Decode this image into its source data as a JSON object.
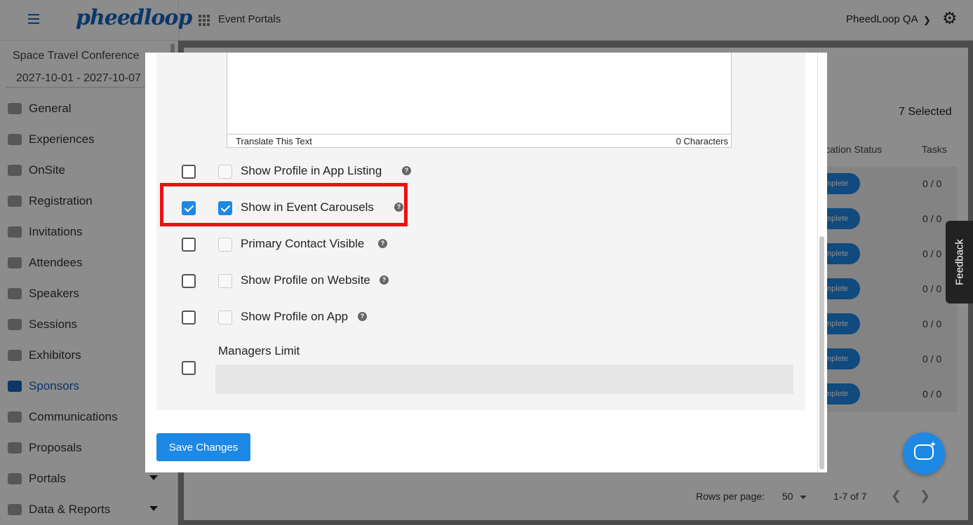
{
  "topbar": {
    "logo": "pheedloop",
    "title": "Event Portals",
    "org": "PheedLoop QA"
  },
  "sidebar": {
    "event_name": "Space Travel Conference",
    "event_dates": "2027-10-01 - 2027-10-07",
    "items": [
      {
        "label": "General"
      },
      {
        "label": "Experiences"
      },
      {
        "label": "OnSite"
      },
      {
        "label": "Registration"
      },
      {
        "label": "Invitations"
      },
      {
        "label": "Attendees"
      },
      {
        "label": "Speakers"
      },
      {
        "label": "Sessions"
      },
      {
        "label": "Exhibitors"
      },
      {
        "label": "Sponsors"
      },
      {
        "label": "Communications"
      },
      {
        "label": "Proposals"
      },
      {
        "label": "Portals"
      },
      {
        "label": "Data & Reports"
      }
    ]
  },
  "background_table": {
    "selected": "7 Selected",
    "col_status": "lication Status",
    "col_tasks": "Tasks",
    "pill": "mplete",
    "tasks": [
      "0 / 0",
      "0 / 0",
      "0 / 0",
      "0 / 0",
      "0 / 0",
      "0 / 0",
      "0 / 0"
    ],
    "rows_per_page_label": "Rows per page:",
    "rows_per_page": "50",
    "range": "1-7 of 7"
  },
  "feedback": "Feedback",
  "modal": {
    "translate_label": "Translate This Text",
    "char_count": "0 Characters",
    "options": [
      {
        "label": "Show Profile in App Listing",
        "checked": false
      },
      {
        "label": "Show in Event Carousels",
        "checked": true
      },
      {
        "label": "Primary Contact Visible",
        "checked": false
      },
      {
        "label": "Show Profile on Website",
        "checked": false
      },
      {
        "label": "Show Profile on App",
        "checked": false
      }
    ],
    "managers_limit_label": "Managers Limit",
    "managers_limit_value": "",
    "save_label": "Save Changes"
  },
  "colors": {
    "accent": "#1e88e5",
    "highlight": "#ee1010"
  }
}
